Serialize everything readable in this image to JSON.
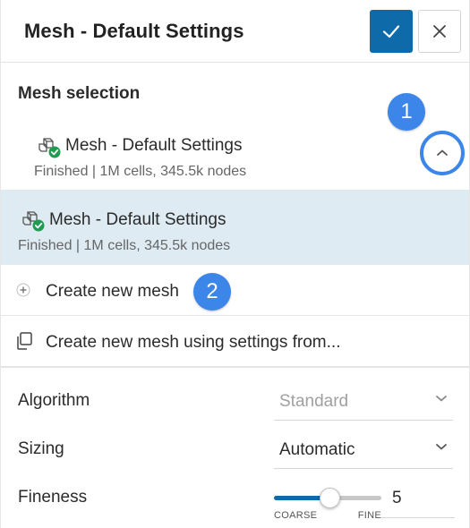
{
  "header": {
    "title": "Mesh - Default Settings",
    "confirm_icon": "check-icon",
    "close_icon": "close-icon"
  },
  "mesh_selection": {
    "label": "Mesh selection",
    "selected": {
      "name": "Mesh - Default Settings",
      "status": "Finished | 1M cells, 345.5k nodes",
      "icon": "mesh-finished-icon"
    },
    "collapse_icon": "chevron-up-icon",
    "options": [
      {
        "name": "Mesh - Default Settings",
        "status": "Finished | 1M cells, 345.5k nodes",
        "icon": "mesh-finished-icon"
      }
    ],
    "actions": {
      "create_new": "Create new mesh",
      "create_from": "Create new mesh using settings from..."
    }
  },
  "annotations": {
    "badge_1": "1",
    "badge_2": "2"
  },
  "settings": {
    "algorithm": {
      "label": "Algorithm",
      "value": "Standard",
      "disabled": true
    },
    "sizing": {
      "label": "Sizing",
      "value": "Automatic"
    },
    "fineness": {
      "label": "Fineness",
      "value": "5",
      "min_label": "COARSE",
      "max_label": "FINE",
      "level_fraction": 0.5
    }
  },
  "colors": {
    "accent": "#0e6aa8",
    "highlight": "#3b86e8",
    "selected_row": "#deebf3",
    "status_green": "#1f9c52"
  }
}
